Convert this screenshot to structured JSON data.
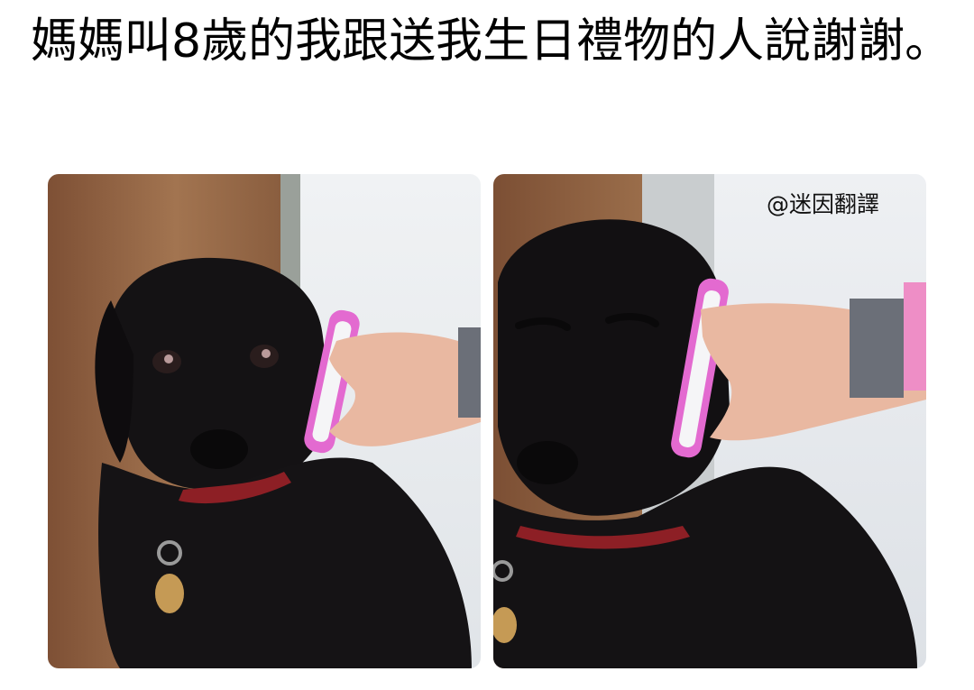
{
  "meme": {
    "caption": "媽媽叫8歲的我跟送我生日禮物的人說謝謝。",
    "watermark": "@迷因翻譯"
  },
  "palette": {
    "background": "#ffffff",
    "text": "#000000",
    "door_wood": "#8a5a3c",
    "wall": "#e9ebee",
    "dog": "#141214",
    "phone": "#e36ad0",
    "skin": "#e9b8a1",
    "collar": "#8d1f25",
    "tag": "#c59a55"
  },
  "icons": {
    "left_phone": "pink-phone-icon",
    "right_phone": "pink-phone-icon"
  }
}
